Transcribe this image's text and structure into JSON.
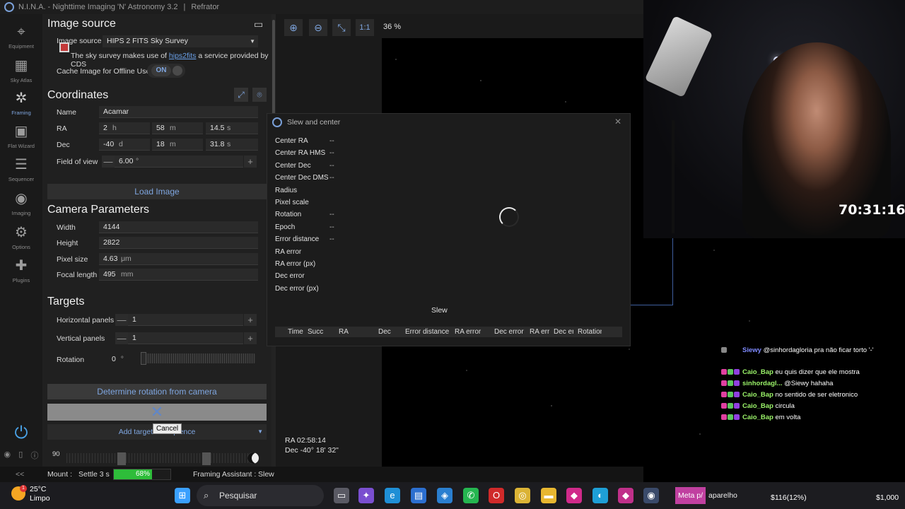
{
  "titlebar": {
    "app_title": "N.I.N.A. - Nighttime Imaging 'N' Astronomy 3.2",
    "profile": "Refrator"
  },
  "sidebar": {
    "items": [
      {
        "label": "Equipment",
        "icon": "equipment-icon"
      },
      {
        "label": "Sky Atlas",
        "icon": "sky-atlas-icon"
      },
      {
        "label": "Framing",
        "icon": "framing-icon"
      },
      {
        "label": "Flat Wizard",
        "icon": "flat-wizard-icon"
      },
      {
        "label": "Sequencer",
        "icon": "sequencer-icon"
      },
      {
        "label": "Imaging",
        "icon": "imaging-icon"
      },
      {
        "label": "Options",
        "icon": "options-icon"
      },
      {
        "label": "Plugins",
        "icon": "plugins-icon"
      }
    ],
    "active": "Framing",
    "collapse_label": "<<"
  },
  "image_source": {
    "title": "Image source",
    "label": "Image source",
    "value": "HIPS 2 FITS Sky Survey",
    "note_prefix": "The sky survey makes use of",
    "note_link": "hips2fits",
    "note_suffix": "a service provided by CDS",
    "cache_label": "Cache Image for Offline Use",
    "cache_toggle": "ON"
  },
  "coordinates": {
    "title": "Coordinates",
    "name_label": "Name",
    "name_value": "Acamar",
    "ra_label": "RA",
    "ra_h": "2",
    "ra_h_unit": "h",
    "ra_m": "58",
    "ra_m_unit": "m",
    "ra_s": "14.5",
    "ra_s_unit": "s",
    "dec_label": "Dec",
    "dec_d": "-40",
    "dec_d_unit": "d",
    "dec_m": "18",
    "dec_m_unit": "m",
    "dec_s": "31.8",
    "dec_s_unit": "s",
    "fov_label": "Field of view",
    "fov_value": "6.00",
    "fov_unit": "°",
    "minus": "—",
    "plus": "+",
    "load_image": "Load Image"
  },
  "camera": {
    "title": "Camera Parameters",
    "width_label": "Width",
    "width_value": "4144",
    "height_label": "Height",
    "height_value": "2822",
    "pixel_label": "Pixel size",
    "pixel_value": "4.63",
    "pixel_unit": "μm",
    "focal_label": "Focal length",
    "focal_value": "495",
    "focal_unit": "mm"
  },
  "targets": {
    "title": "Targets",
    "hpanels_label": "Horizontal panels",
    "hpanels_value": "1",
    "vpanels_label": "Vertical panels",
    "vpanels_value": "1",
    "rotation_label": "Rotation",
    "rotation_value": "0",
    "rotation_unit": "°",
    "determine_rotation": "Determine rotation from camera",
    "add_target": "Add target to sequence",
    "cancel_tooltip": "Cancel",
    "bottom_value": "90"
  },
  "canvas": {
    "zoom_level": "36 %",
    "one_to_one": "1:1",
    "ra_readout": "RA  02:58:14",
    "dec_readout": "Dec  -40° 18' 32\""
  },
  "slew_dialog": {
    "title": "Slew and center",
    "close": "✕",
    "rows": [
      {
        "label": "Center RA",
        "value": "--"
      },
      {
        "label": "Center RA HMS",
        "value": "--"
      },
      {
        "label": "Center Dec",
        "value": "--"
      },
      {
        "label": "Center Dec DMS",
        "value": "--"
      },
      {
        "label": "Radius",
        "value": ""
      },
      {
        "label": "Pixel scale",
        "value": ""
      },
      {
        "label": "Rotation",
        "value": "--"
      },
      {
        "label": "Epoch",
        "value": "--"
      },
      {
        "label": "Error distance",
        "value": "--"
      },
      {
        "label": "RA error",
        "value": ""
      },
      {
        "label": "RA error (px)",
        "value": ""
      },
      {
        "label": "Dec error",
        "value": ""
      },
      {
        "label": "Dec error (px)",
        "value": ""
      }
    ],
    "slew_button": "Slew",
    "columns": [
      "Time",
      "Succ",
      "RA",
      "Dec",
      "Error distance",
      "RA error",
      "Dec error",
      "RA erro",
      "Dec err",
      "Rotation"
    ]
  },
  "webcam": {
    "timer": "70:31:16"
  },
  "chat": [
    {
      "user": "Siewy",
      "message": "@sinhordagloria pra não ficar torto '-'",
      "color": "#7f8bff"
    },
    {
      "user": "Caio_Bap",
      "message": "eu quis dizer que ele mostra",
      "color": "#9cf56a"
    },
    {
      "user": "sinhordagl...",
      "message": "@Siewy hahaha",
      "color": "#9cf56a"
    },
    {
      "user": "Caio_Bap",
      "message": "no sentido de ser eletronico",
      "color": "#9cf56a"
    },
    {
      "user": "Caio_Bap",
      "message": "circula",
      "color": "#9cf56a"
    },
    {
      "user": "Caio_Bap",
      "message": "em volta",
      "color": "#9cf56a"
    }
  ],
  "statusbar": {
    "mount_label": "Mount :",
    "settle": "Settle 3 s",
    "progress_text": "68%",
    "progress_fraction": 0.68,
    "framing_label": "Framing Assistant :",
    "framing_value": "Slew"
  },
  "taskbar": {
    "weather_temp": "25°C",
    "weather_desc": "Limpo",
    "weather_badge": "1",
    "search_placeholder": "Pesquisar",
    "meta_label": "Meta p/",
    "meta_suffix": "aparelho",
    "money_progress": "$116(12%)",
    "money_goal": "$1,000"
  }
}
